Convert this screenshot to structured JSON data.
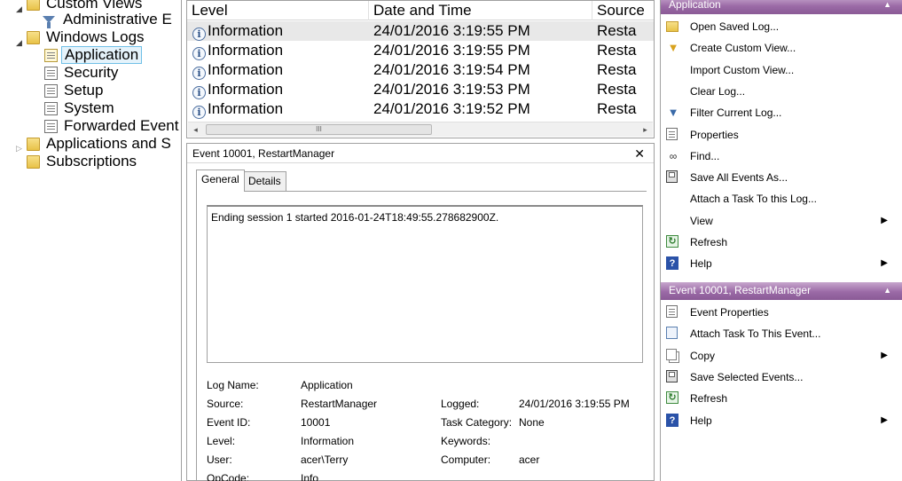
{
  "tree": {
    "custom_views": "Custom Views",
    "administrative": "Administrative E",
    "windows_logs": "Windows Logs",
    "application": "Application",
    "security": "Security",
    "setup": "Setup",
    "system": "System",
    "forwarded": "Forwarded Event",
    "apps_services": "Applications and S",
    "subscriptions": "Subscriptions"
  },
  "grid": {
    "columns": [
      "Level",
      "Date and Time",
      "Source"
    ],
    "rows": [
      {
        "level": "Information",
        "datetime": "24/01/2016 3:19:55 PM",
        "source": "Resta"
      },
      {
        "level": "Information",
        "datetime": "24/01/2016 3:19:55 PM",
        "source": "Resta"
      },
      {
        "level": "Information",
        "datetime": "24/01/2016 3:19:54 PM",
        "source": "Resta"
      },
      {
        "level": "Information",
        "datetime": "24/01/2016 3:19:53 PM",
        "source": "Resta"
      },
      {
        "level": "Information",
        "datetime": "24/01/2016 3:19:52 PM",
        "source": "Resta"
      }
    ],
    "scroll_grip": "III"
  },
  "detail": {
    "title": "Event 10001, RestartManager",
    "close": "✕",
    "tabs": [
      "General",
      "Details"
    ],
    "description": "Ending session 1 started 2016-01-24T18:49:55.278682900Z.",
    "fields": {
      "log_name_label": "Log Name:",
      "log_name": "Application",
      "source_label": "Source:",
      "source": "RestartManager",
      "logged_label": "Logged:",
      "logged": "24/01/2016 3:19:55 PM",
      "event_id_label": "Event ID:",
      "event_id": "10001",
      "task_category_label": "Task Category:",
      "task_category": "None",
      "level_label": "Level:",
      "level": "Information",
      "keywords_label": "Keywords:",
      "user_label": "User:",
      "user": "acer\\Terry",
      "computer_label": "Computer:",
      "computer": "acer",
      "opcode_label": "OpCode:",
      "opcode": "Info"
    }
  },
  "actions": {
    "section1": "Application",
    "items1": [
      {
        "label": "Open Saved Log...",
        "icon": "folder-open-icon",
        "submenu": false
      },
      {
        "label": "Create Custom View...",
        "icon": "funnel-star-icon",
        "submenu": false
      },
      {
        "label": "Import Custom View...",
        "icon": "",
        "submenu": false
      },
      {
        "label": "Clear Log...",
        "icon": "",
        "submenu": false
      },
      {
        "label": "Filter Current Log...",
        "icon": "funnel-icon",
        "submenu": false
      },
      {
        "label": "Properties",
        "icon": "properties-icon",
        "submenu": false
      },
      {
        "label": "Find...",
        "icon": "binoculars-icon",
        "submenu": false
      },
      {
        "label": "Save All Events As...",
        "icon": "save-icon",
        "submenu": false
      },
      {
        "label": "Attach a Task To this Log...",
        "icon": "",
        "submenu": false
      },
      {
        "label": "View",
        "icon": "",
        "submenu": true
      },
      {
        "label": "Refresh",
        "icon": "refresh-icon",
        "submenu": false
      },
      {
        "label": "Help",
        "icon": "help-icon",
        "submenu": true
      }
    ],
    "section2": "Event 10001, RestartManager",
    "items2": [
      {
        "label": "Event Properties",
        "icon": "properties-icon",
        "submenu": false
      },
      {
        "label": "Attach Task To This Event...",
        "icon": "task-icon",
        "submenu": false
      },
      {
        "label": "Copy",
        "icon": "copy-icon",
        "submenu": true
      },
      {
        "label": "Save Selected Events...",
        "icon": "save-icon",
        "submenu": false
      },
      {
        "label": "Refresh",
        "icon": "refresh-icon",
        "submenu": false
      },
      {
        "label": "Help",
        "icon": "help-icon",
        "submenu": true
      }
    ]
  }
}
